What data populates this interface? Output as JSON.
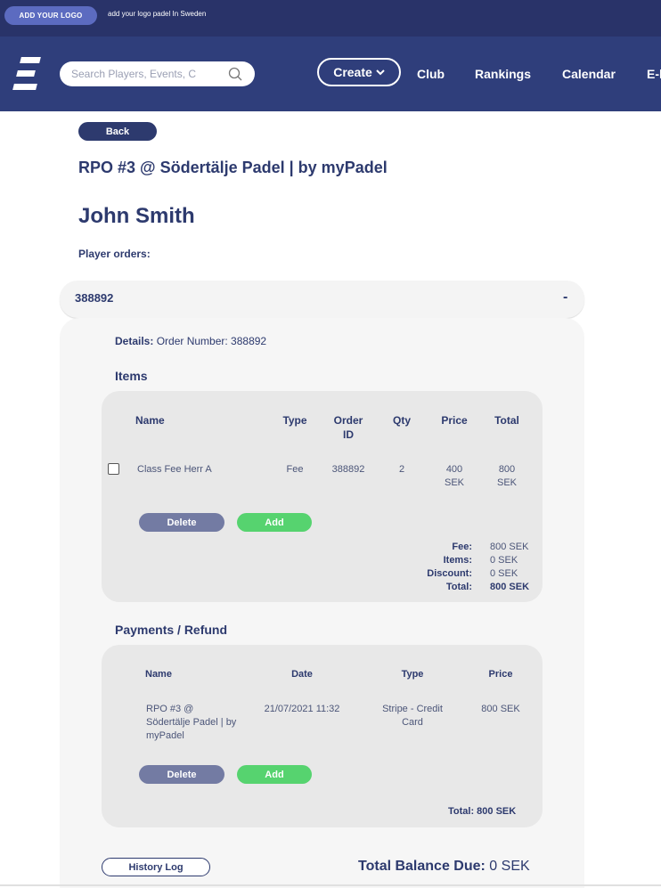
{
  "topbar": {
    "logo_button": "ADD YOUR LOGO",
    "tagline": "add your logo padel In Sweden"
  },
  "nav": {
    "search_placeholder": "Search Players, Events, C",
    "create_label": "Create",
    "links": [
      "Club",
      "Rankings",
      "Calendar",
      "E-l"
    ]
  },
  "page": {
    "back_label": "Back",
    "event_title": "RPO #3 @ Södertälje Padel | by myPadel",
    "player_name": "John Smith",
    "orders_label": "Player orders:"
  },
  "order": {
    "number": "388892",
    "toggle": "-",
    "details_label": "Details:",
    "details_value": "Order Number: 388892",
    "items": {
      "title": "Items",
      "headers": [
        "Name",
        "Type",
        "Order ID",
        "Qty",
        "Price",
        "Total"
      ],
      "rows": [
        {
          "name": "Class Fee Herr A",
          "type": "Fee",
          "order_id": "388892",
          "qty": "2",
          "price": "400 SEK",
          "total": "800 SEK"
        }
      ],
      "delete_label": "Delete",
      "add_label": "Add",
      "summary": [
        {
          "label": "Fee:",
          "value": "800 SEK"
        },
        {
          "label": "Items:",
          "value": "0 SEK"
        },
        {
          "label": "Discount:",
          "value": "0 SEK"
        },
        {
          "label": "Total:",
          "value": "800 SEK"
        }
      ]
    },
    "payments": {
      "title": "Payments / Refund",
      "headers": [
        "Name",
        "Date",
        "Type",
        "Price"
      ],
      "rows": [
        {
          "name": "RPO #3 @ Södertälje Padel | by myPadel",
          "date": "21/07/2021 11:32",
          "type": "Stripe - Credit Card",
          "price": "800 SEK"
        }
      ],
      "delete_label": "Delete",
      "add_label": "Add",
      "total": "Total: 800 SEK"
    },
    "history_label": "History Log",
    "balance_label": "Total Balance Due:",
    "balance_value": "0 SEK"
  },
  "colors": {
    "navy": "#2f3e7b",
    "topbar": "#293369",
    "accent_green": "#56d36f",
    "delete_gray": "#737ba3"
  }
}
